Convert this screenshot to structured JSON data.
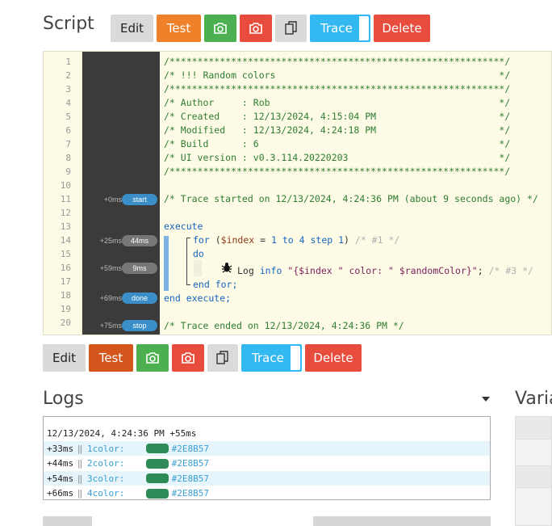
{
  "script_title": "Script",
  "toolbar_top": {
    "edit": "Edit",
    "test": "Test",
    "trace": "Trace",
    "delete": "Delete"
  },
  "toolbar_bottom": {
    "edit": "Edit",
    "test": "Test",
    "trace": "Trace",
    "delete": "Delete"
  },
  "editor": {
    "line_numbers": [
      "1",
      "2",
      "3",
      "4",
      "5",
      "6",
      "7",
      "8",
      "9",
      "10",
      "11",
      "12",
      "13",
      "14",
      "15",
      "16",
      "17",
      "18",
      "19",
      "20"
    ],
    "header": [
      "/************************************************************/",
      "/* !!! Random colors                                        */",
      "/************************************************************/",
      "/* Author     : Rob                                         */",
      "/* Created    : 12/13/2024, 4:15:04 PM                      */",
      "/* Modified   : 12/13/2024, 4:24:18 PM                      */",
      "/* Build      : 6                                           */",
      "/* UI version : v0.3.114.20220203                           */",
      "/************************************************************/"
    ],
    "trace_start": "/* Trace started on 12/13/2024, 4:24:36 PM (about 9 seconds ago) */",
    "execute": "execute",
    "for_kw": "for",
    "for_open": " (",
    "for_var": "$index",
    "for_eq": " = ",
    "for_from": "1",
    "for_to": " to ",
    "for_to_n": "4",
    "for_step": " step ",
    "for_step_n": "1",
    "for_close": ")",
    "for_comment": " /* #1 */",
    "do_kw": "do",
    "log_kw": "Log",
    "log_level": " info",
    "log_str": " \"{$index \" color: \" $randomColor}\"",
    "log_semi": ";",
    "log_comment": " /* #3 */",
    "end_for": "end for;",
    "end_execute": "end execute;",
    "trace_end": "/* Trace ended on 12/13/2024, 4:24:36 PM */"
  },
  "trace_markers": [
    {
      "time": "+0ms",
      "label": "start",
      "kind": "blue"
    },
    {
      "time": "+25ms",
      "label": "44ms",
      "kind": "gray"
    },
    {
      "time": "+59ms",
      "label": "9ms",
      "kind": "gray"
    },
    {
      "time": "+69ms",
      "label": "done",
      "kind": "blue"
    },
    {
      "time": "+75ms",
      "label": "stop",
      "kind": "blue"
    }
  ],
  "logs_title": "Logs",
  "variables_title": "Varia",
  "log_header": "12/13/2024, 4:24:36 PM +55ms",
  "log_rows": [
    {
      "time": "+33ms",
      "sep": "‖",
      "index": "1",
      "text": " color:",
      "hex": "#2E8B57"
    },
    {
      "time": "+44ms",
      "sep": "‖",
      "index": "2",
      "text": " color:",
      "hex": "#2E8B57"
    },
    {
      "time": "+54ms",
      "sep": "‖",
      "index": "3",
      "text": " color:",
      "hex": "#2E8B57"
    },
    {
      "time": "+66ms",
      "sep": "‖",
      "index": "4",
      "text": " color:",
      "hex": "#2E8B57"
    }
  ],
  "colors": {
    "swatch": "#2E8B57",
    "trace_blue": "#34B8F2",
    "delete_red": "#E74C3C"
  },
  "icons": [
    "camera-icon",
    "camera-icon",
    "copy-icon",
    "bug-icon",
    "chevron-down-icon"
  ]
}
